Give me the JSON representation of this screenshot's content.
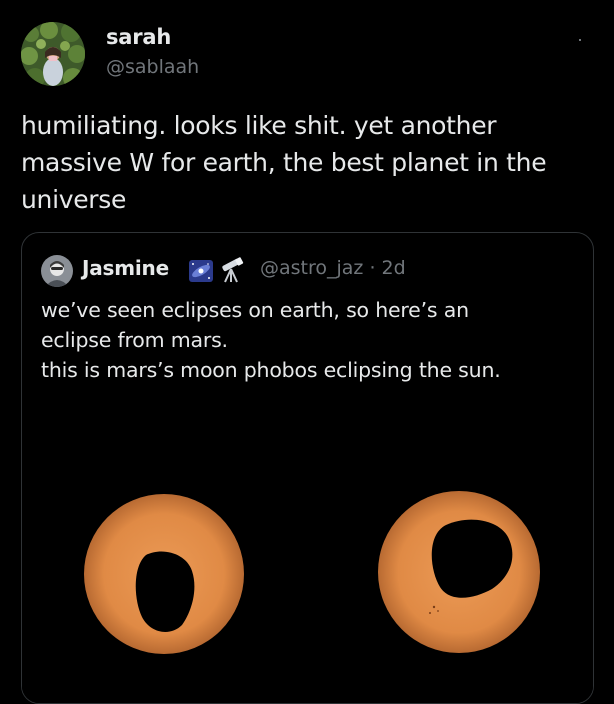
{
  "author": {
    "display_name": "sarah",
    "handle": "@sablaah",
    "avatar_icon": "profile-photo-icon"
  },
  "tweet": {
    "text": "humiliating. looks like shit. yet another massive W for earth, the best planet in the universe",
    "more_icon": "more-options-icon"
  },
  "quoted": {
    "display_name": "Jasmine",
    "badges": [
      "galaxy-emoji-icon",
      "telescope-emoji-icon"
    ],
    "handle": "@astro_jaz",
    "separator": "·",
    "time": "2d",
    "text_lines": [
      "we’ve seen eclipses on earth, so here’s an",
      "eclipse from mars.",
      "this is mars’s moon phobos eclipsing the sun."
    ],
    "media": {
      "description_icon": "eclipse-photo-icon",
      "sun_color": "#e08a45",
      "shadow_color": "#000000"
    }
  },
  "colors": {
    "background": "#000000",
    "text_primary": "#e7e9ea",
    "text_secondary": "#71767b",
    "border": "#2f3336"
  }
}
